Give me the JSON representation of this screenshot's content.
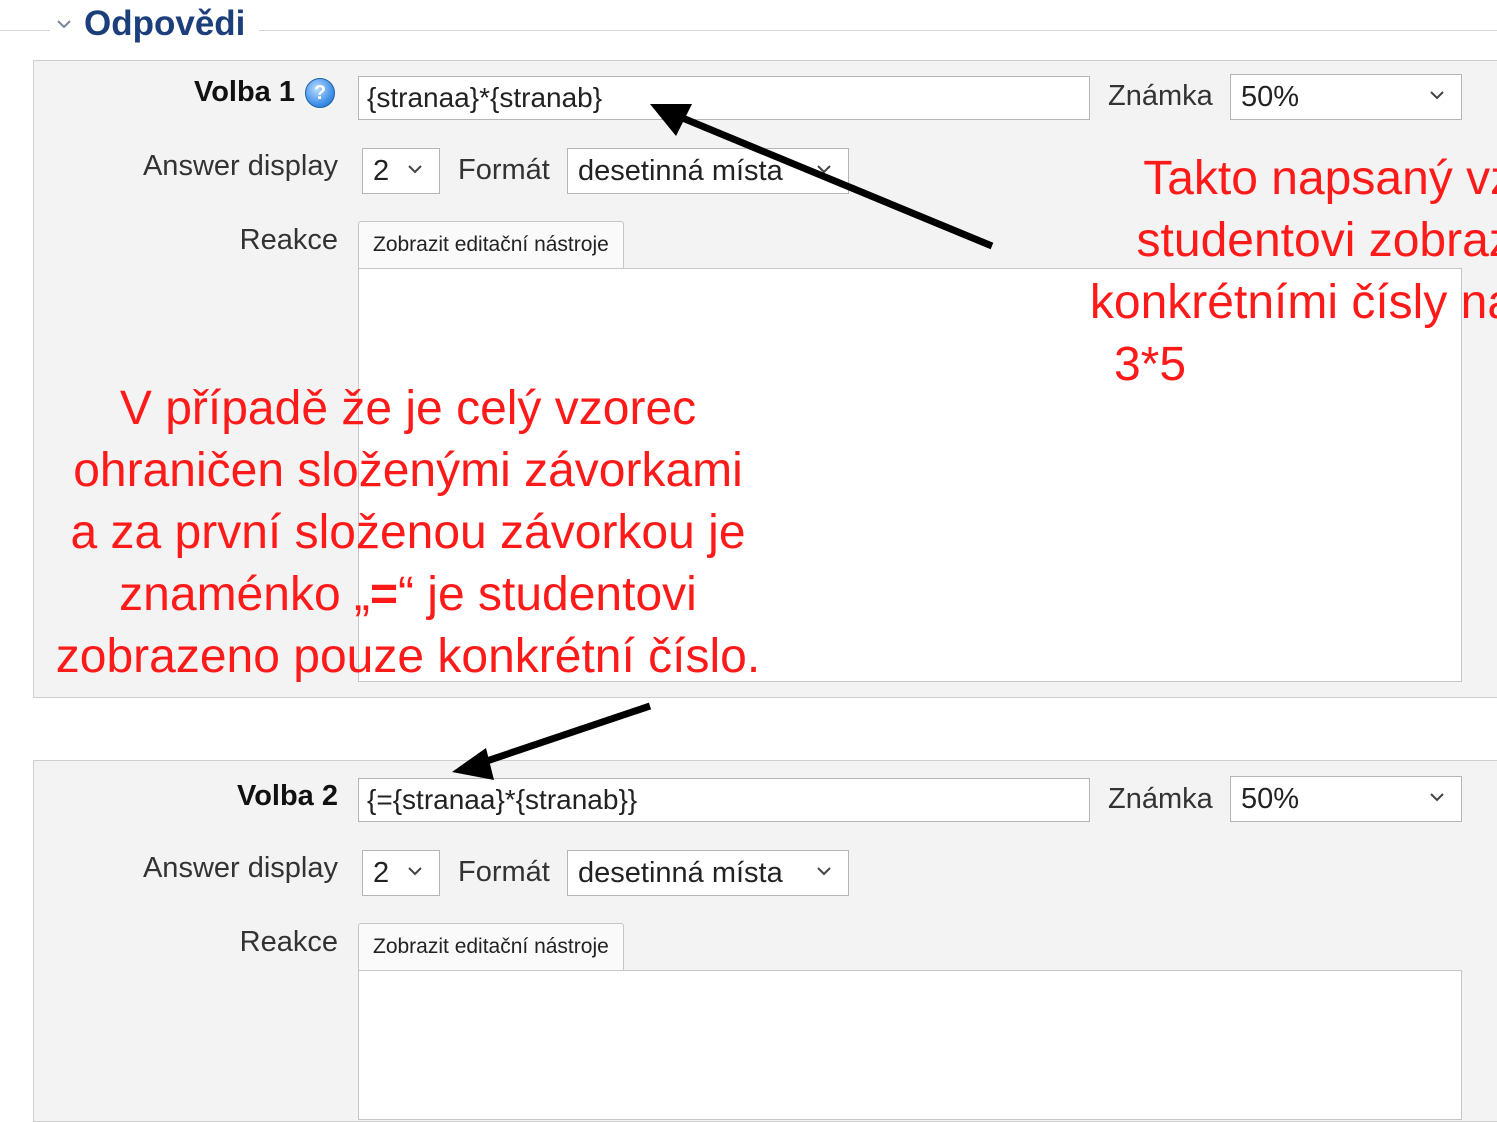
{
  "fieldset": {
    "legend": "Odpovědi"
  },
  "answers": [
    {
      "choice_label": "Volba 1",
      "formula": "{stranaa}*{stranab}",
      "grade_label": "Známka",
      "grade_value": "50%",
      "answer_display_label": "Answer display",
      "answer_display_value": "2",
      "format_label": "Formát",
      "format_value": "desetinná místa",
      "feedback_label": "Reakce",
      "editor_tab": "Zobrazit editační nástroje"
    },
    {
      "choice_label": "Volba 2",
      "formula": "{={stranaa}*{stranab}}",
      "grade_label": "Známka",
      "grade_value": "50%",
      "answer_display_label": "Answer display",
      "answer_display_value": "2",
      "format_label": "Formát",
      "format_value": "desetinná místa",
      "feedback_label": "Reakce",
      "editor_tab": "Zobrazit editační nástroje"
    }
  ],
  "annotations": {
    "right_note": [
      "Takto napsaný vzor",
      "studentovi zobrazí v",
      "konkrétními čísly napří",
      "3*5"
    ],
    "left_note": [
      "V případě že je celý vzorec",
      "ohraničen složenými závorkami",
      "a za první složenou závorkou je"
    ],
    "left_note_line4": {
      "before": "znaménko „",
      "emph": "=",
      "after": "“ je studentovi"
    },
    "left_note_line5": "zobrazeno pouze konkrétní číslo."
  },
  "colors": {
    "legend": "#1c3f7b",
    "annotation": "#ff1a1a",
    "panel": "#f3f3f3"
  },
  "icons": [
    "help-icon",
    "chevron-down-icon",
    "collapse-chevron-icon",
    "arrow-icon"
  ]
}
